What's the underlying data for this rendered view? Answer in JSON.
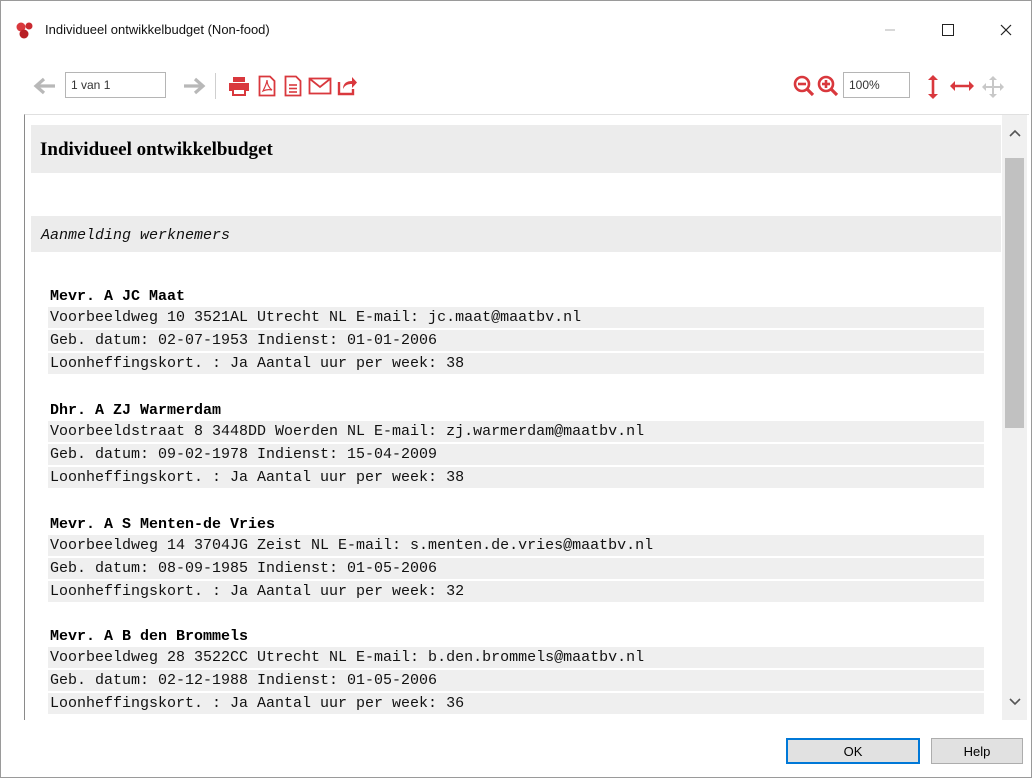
{
  "window": {
    "title": "Individueel ontwikkelbudget (Non-food)"
  },
  "toolbar": {
    "page_value": "1 van 1",
    "zoom_value": "100%"
  },
  "report": {
    "title": "Individueel ontwikkelbudget",
    "section": "Aanmelding werknemers",
    "employees": [
      {
        "name": "Mevr. A JC Maat",
        "address": "Voorbeeldweg 10 3521AL Utrecht NL E-mail: jc.maat@maatbv.nl",
        "dates": "Geb. datum: 02-07-1953 Indienst: 01-01-2006",
        "hours": "Loonheffingskort. : Ja Aantal uur per week: 38"
      },
      {
        "name": "Dhr. A ZJ Warmerdam",
        "address": "Voorbeeldstraat 8 3448DD Woerden NL E-mail: zj.warmerdam@maatbv.nl",
        "dates": "Geb. datum: 09-02-1978 Indienst: 15-04-2009",
        "hours": "Loonheffingskort. : Ja Aantal uur per week: 38"
      },
      {
        "name": "Mevr. A S Menten-de Vries",
        "address": "Voorbeeldweg 14 3704JG Zeist NL E-mail: s.menten.de.vries@maatbv.nl",
        "dates": "Geb. datum: 08-09-1985 Indienst: 01-05-2006",
        "hours": "Loonheffingskort. : Ja Aantal uur per week: 32"
      },
      {
        "name": "Mevr. A B den Brommels",
        "address": "Voorbeeldweg 28 3522CC Utrecht NL E-mail: b.den.brommels@maatbv.nl",
        "dates": "Geb. datum: 02-12-1988 Indienst: 01-05-2006",
        "hours": "Loonheffingskort. : Ja Aantal uur per week: 36"
      }
    ]
  },
  "buttons": {
    "ok": "OK",
    "help": "Help"
  },
  "colors": {
    "toolbar_red": "#d9383d",
    "toolbar_grey": "#b8b8b8",
    "row_bg": "#efefef"
  }
}
